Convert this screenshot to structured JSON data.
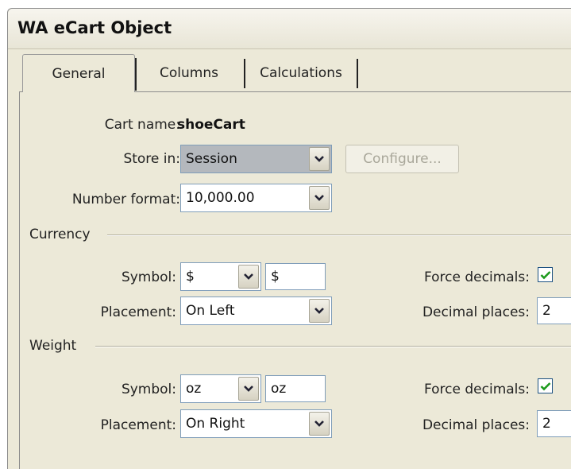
{
  "window": {
    "title": "WA eCart Object"
  },
  "tabs": [
    {
      "label": "General"
    },
    {
      "label": "Columns"
    },
    {
      "label": "Calculations"
    }
  ],
  "general": {
    "cart_name_label": "Cart name:",
    "cart_name_value": "shoeCart",
    "store_in_label": "Store in:",
    "store_in_value": "Session",
    "configure_label": "Configure...",
    "number_format_label": "Number format:",
    "number_format_value": "10,000.00"
  },
  "currency": {
    "group_label": "Currency",
    "symbol_label": "Symbol:",
    "symbol_select_value": "$",
    "symbol_input_value": "$",
    "placement_label": "Placement:",
    "placement_value": "On Left",
    "force_decimals_label": "Force decimals:",
    "force_decimals_checked": true,
    "decimal_places_label": "Decimal places:",
    "decimal_places_value": "2"
  },
  "weight": {
    "group_label": "Weight",
    "symbol_label": "Symbol:",
    "symbol_select_value": "oz",
    "symbol_input_value": "oz",
    "placement_label": "Placement:",
    "placement_value": "On Right",
    "force_decimals_label": "Force decimals:",
    "force_decimals_checked": true,
    "decimal_places_label": "Decimal places:",
    "decimal_places_value": "2"
  },
  "colors": {
    "check": "#1c9a1c",
    "select_highlight": "#b4b8bd"
  }
}
